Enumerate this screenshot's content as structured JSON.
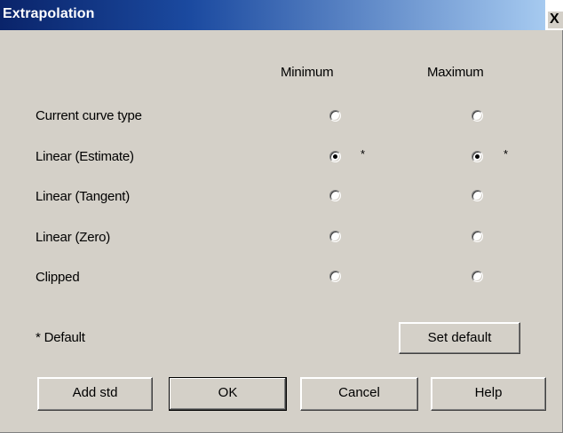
{
  "window": {
    "title": "Extrapolation",
    "close_label": "X"
  },
  "columns": {
    "minimum": "Minimum",
    "maximum": "Maximum"
  },
  "rows": [
    {
      "label": "Current curve type",
      "min_selected": false,
      "max_selected": false,
      "min_default": false,
      "max_default": false
    },
    {
      "label": "Linear (Estimate)",
      "min_selected": true,
      "max_selected": true,
      "min_default": true,
      "max_default": true
    },
    {
      "label": "Linear (Tangent)",
      "min_selected": false,
      "max_selected": false,
      "min_default": false,
      "max_default": false
    },
    {
      "label": "Linear (Zero)",
      "min_selected": false,
      "max_selected": false,
      "min_default": false,
      "max_default": false
    },
    {
      "label": "Clipped",
      "min_selected": false,
      "max_selected": false,
      "min_default": false,
      "max_default": false
    }
  ],
  "default_marker": "*",
  "default_note": "* Default",
  "buttons": {
    "set_default": "Set default",
    "add_std": "Add std",
    "ok": "OK",
    "cancel": "Cancel",
    "help": "Help"
  },
  "colors": {
    "titlebar_start": "#0a246a",
    "titlebar_end": "#a6caf0",
    "face": "#d4d0c8"
  }
}
